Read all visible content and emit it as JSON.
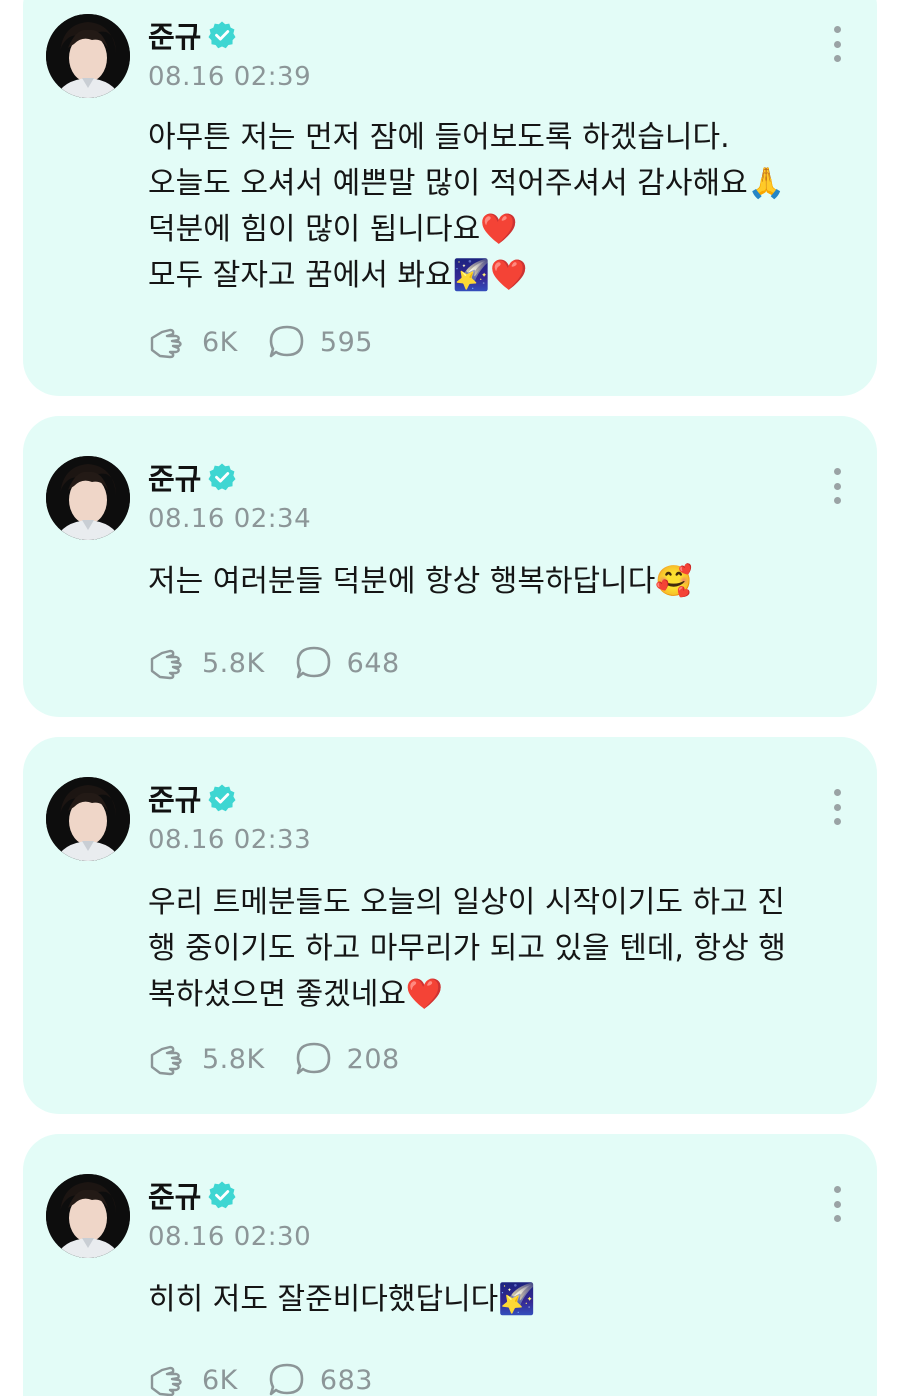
{
  "author": {
    "name": "준규",
    "verified_icon": "verified-check-icon",
    "badge_color": "#3ed6d2"
  },
  "colors": {
    "card_bg": "#e3fcf7",
    "muted": "#8c9698"
  },
  "posts": [
    {
      "time": "08.16 02:39",
      "lines": [
        "아무튼 저는 먼저 잠에 들어보도록 하겠습니다.",
        "오늘도 오셔서 예쁜말 많이 적어주셔서 감사해요🙏",
        "덕분에 힘이 많이 됩니다요❤️",
        "모두 잘자고 꿈에서 봐요🌠❤️"
      ],
      "likes": "6K",
      "comments": "595"
    },
    {
      "time": "08.16 02:34",
      "lines": [
        "저는 여러분들 덕분에 항상 행복하답니다🥰"
      ],
      "likes": "5.8K",
      "comments": "648"
    },
    {
      "time": "08.16 02:33",
      "lines": [
        "우리 트메분들도 오늘의 일상이 시작이기도 하고 진",
        "행 중이기도 하고 마무리가 되고 있을 텐데, 항상 행",
        "복하셨으면 좋겠네요❤️"
      ],
      "likes": "5.8K",
      "comments": "208"
    },
    {
      "time": "08.16 02:30",
      "lines": [
        "히히 저도 잘준비다했답니다🌠"
      ],
      "likes": "6K",
      "comments": "683"
    }
  ]
}
